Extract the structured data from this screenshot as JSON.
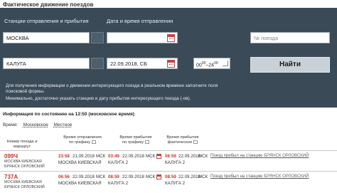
{
  "page": {
    "title": "Фактическое движение поездов"
  },
  "form": {
    "stations_label": "Станции отправления и прибытия",
    "datetime_label": "Дата и время отправления",
    "from_station": "МОСКВА",
    "to_station": "КАЛУГА",
    "date_placeholder": "",
    "date_value": "22.09.2018, СБ",
    "time_from": "00",
    "time_from_sup": "00",
    "time_sep": "–",
    "time_to": "24",
    "time_to_sup": "00",
    "train_placeholder": "№ поезда",
    "find_label": "Найти",
    "note_line1": "Для получения информации о движении интересующего поезда в реальном времени заполните поля",
    "note_line2": "поисковой формы.",
    "note_line3": "Минимально, достаточно указать станцию и дату прибытия интересующего поезда (-ов)."
  },
  "info": {
    "header": "Информация по состоянию на 12:50 (московское время)",
    "time_label": "Время:",
    "time_opt_moscow": "Московское",
    "time_opt_local": "Местное"
  },
  "table": {
    "col_train": "Номер поезда и маршрут",
    "col_dep_1": "Время отправления",
    "col_dep_2": "по графику",
    "col_arr_1": "Время прибытия",
    "col_arr_2": "по графику",
    "col_fact_1": "Время прибытия",
    "col_fact_2": "фактическое",
    "rows": [
      {
        "num": "099Ч",
        "route1": "МОСКВА КИЕВСКАЯ",
        "route2": "БРЯНСК ОРЛОВСКИЙ",
        "dep_time": "23:58",
        "dep_date": "21.09.2018",
        "dep_tz": "МСК",
        "dep_station": "МОСКВА КИЕВСКАЯ",
        "arr_time": "03:49",
        "arr_date": "22.09.2018",
        "arr_tz": "МСК",
        "arr_station": "КАЛУГА 2",
        "fact_time": "06:59",
        "fact_date": "22.09.2018",
        "fact_tz": "МСК",
        "fact_station": "КАЛУГА 2",
        "status_text": "Поезд прибыл на станцию",
        "status_station": "БРЯНСК ОРЛОВСКИЙ"
      },
      {
        "num": "737А",
        "route1": "МОСКВА КИЕВСКАЯ",
        "route2": "БРЯНСК ОРЛОВСКИЙ",
        "dep_time": "06:56",
        "dep_date": "22.09.2018",
        "dep_tz": "МСК",
        "dep_station": "МОСКВА КИЕВСКАЯ",
        "arr_time": "08:59",
        "arr_date": "22.09.2018",
        "arr_tz": "МСК",
        "arr_station": "КАЛУГА 2",
        "fact_time": "08:59",
        "fact_date": "22.09.2018",
        "fact_tz": "МСК",
        "fact_station": "КАЛУГА 2",
        "status_text": "Поезд прибыл на станцию",
        "status_station": "БРЯНСК ОРЛОВСКИЙ"
      }
    ]
  },
  "colors": {
    "panel": "#3b4a57",
    "accent_red": "#c0392b",
    "button": "#c9d1d8"
  }
}
